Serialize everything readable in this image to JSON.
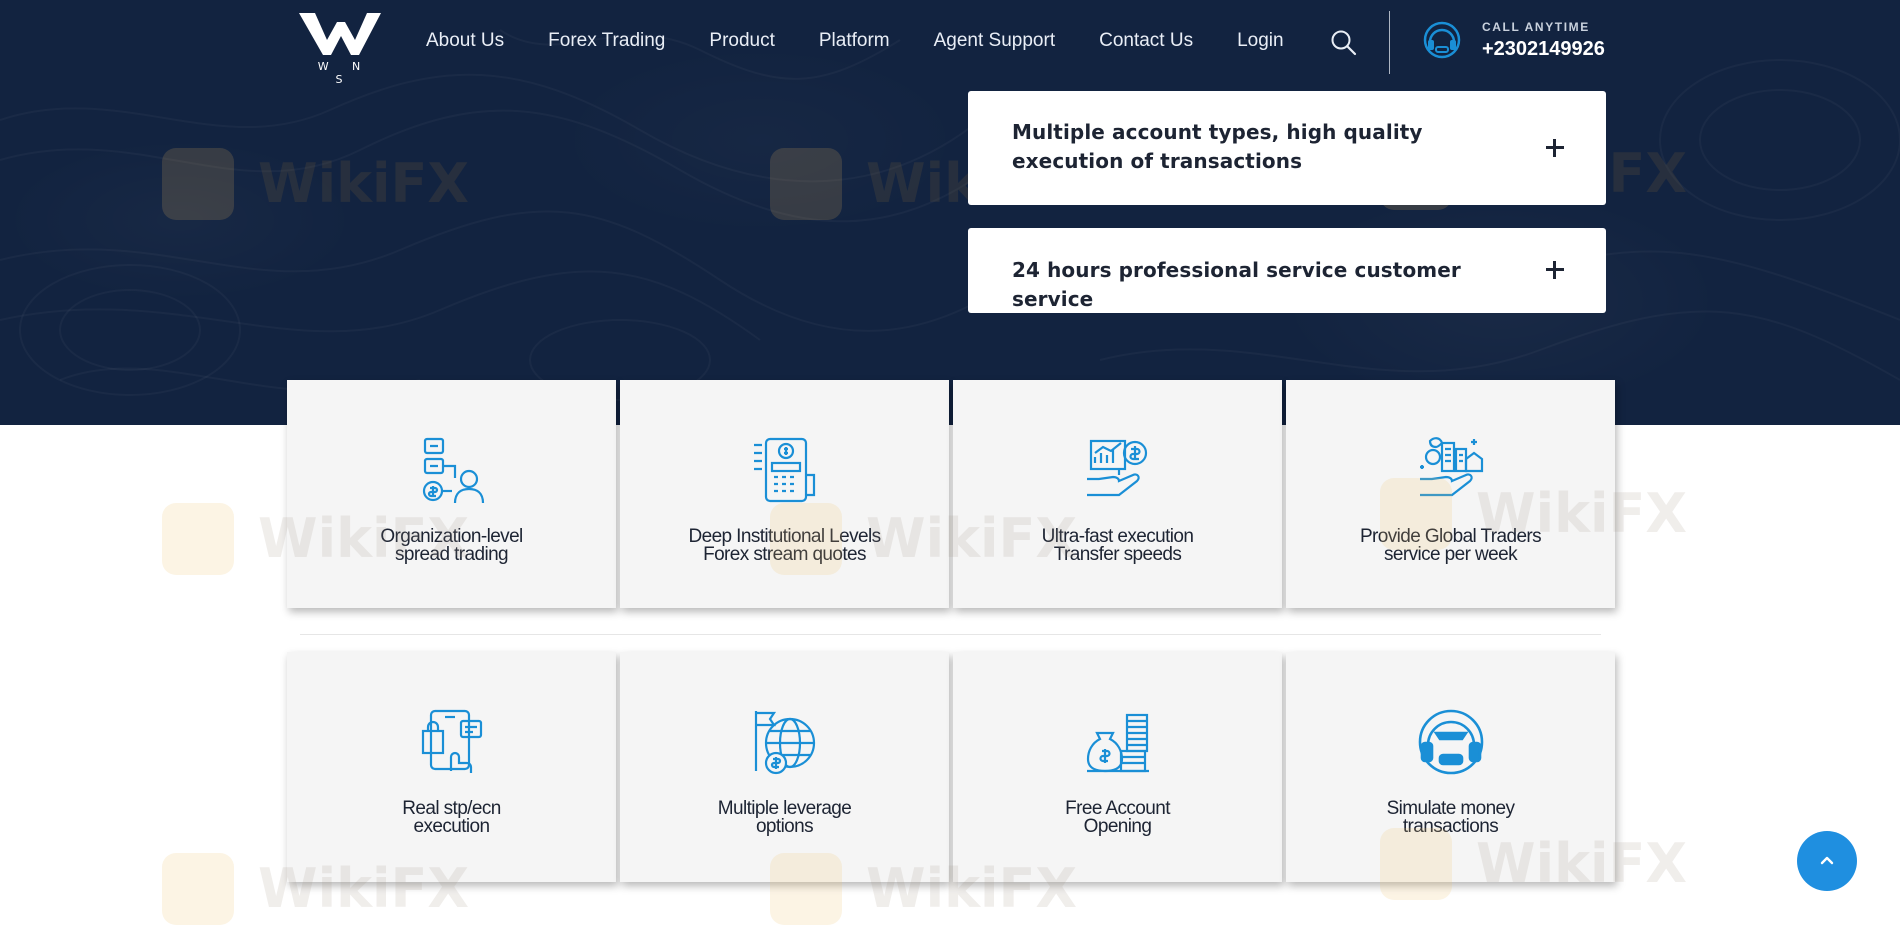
{
  "brand": {
    "logo_text": "W N S",
    "colors": {
      "navy": "#122340",
      "accent": "#1f8fe0",
      "icon_blue": "#1a8fd6",
      "card_bg": "#f5f5f5"
    }
  },
  "nav": {
    "items": [
      "About Us",
      "Forex Trading",
      "Product",
      "Platform",
      "Agent Support",
      "Contact Us",
      "Login"
    ],
    "search_icon": "search-icon"
  },
  "contact": {
    "icon": "headset-support-icon",
    "label": "CALL ANYTIME",
    "number": "+2302149926"
  },
  "accordion": [
    {
      "title": "Multiple account types, high quality execution of transactions",
      "toggle": "+"
    },
    {
      "title": "24 hours professional service customer service",
      "toggle": "+"
    }
  ],
  "features": [
    {
      "line1": "Organization-level",
      "line2": "spread trading",
      "icon": "org-spread-icon"
    },
    {
      "line1": "Deep Institutional Levels",
      "line2": "Forex stream quotes",
      "icon": "pos-terminal-icon"
    },
    {
      "line1": "Ultra-fast execution",
      "line2": "Transfer speeds",
      "icon": "hand-chart-coin-icon"
    },
    {
      "line1": "Provide Global Traders",
      "line2": "service per week",
      "icon": "hand-city-icon"
    },
    {
      "line1": "Real stp/ecn",
      "line2": "execution",
      "icon": "mobile-shopping-icon"
    },
    {
      "line1": "Multiple leverage",
      "line2": "options",
      "icon": "globe-coin-icon"
    },
    {
      "line1": "Free Account",
      "line2": "Opening",
      "icon": "money-bag-stack-icon"
    },
    {
      "line1": "Simulate money",
      "line2": "transactions",
      "icon": "headset-agent-icon"
    }
  ],
  "watermark": "WikiFX",
  "back_to_top_icon": "chevron-up-icon"
}
